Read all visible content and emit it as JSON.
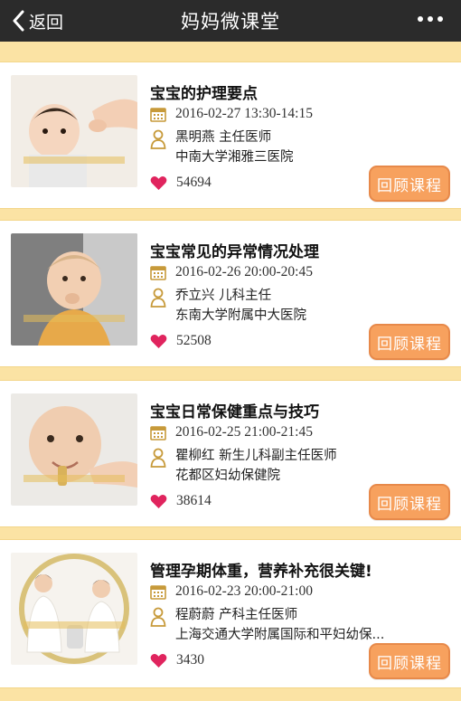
{
  "header": {
    "back_label": "返回",
    "title": "妈妈微课堂",
    "more_icon": "more-icon"
  },
  "courses": [
    {
      "title": "宝宝的护理要点",
      "datetime": "2016-02-27 13:30-14:15",
      "teacher": "黑明燕 主任医师",
      "hospital": "中南大学湘雅三医院",
      "likes": "54694",
      "button": "回顾课程"
    },
    {
      "title": "宝宝常见的异常情况处理",
      "datetime": "2016-02-26 20:00-20:45",
      "teacher": "乔立兴 儿科主任",
      "hospital": "东南大学附属中大医院",
      "likes": "52508",
      "button": "回顾课程"
    },
    {
      "title": "宝宝日常保健重点与技巧",
      "datetime": "2016-02-25 21:00-21:45",
      "teacher": "瞿柳红 新生儿科副主任医师",
      "hospital": "花都区妇幼保健院",
      "likes": "38614",
      "button": "回顾课程"
    },
    {
      "title": "管理孕期体重，营养补充很关键!",
      "datetime": "2016-02-23 20:00-21:00",
      "teacher": "程蔚蔚 产科主任医师",
      "hospital": "上海交通大学附属国际和平妇幼保...",
      "likes": "3430",
      "button": "回顾课程"
    }
  ],
  "colors": {
    "topbar": "#2b2b2b",
    "separator": "#fbe3a4",
    "button": "#f7a15e",
    "heart": "#e0245e",
    "icon_gold": "#c79a3a"
  }
}
